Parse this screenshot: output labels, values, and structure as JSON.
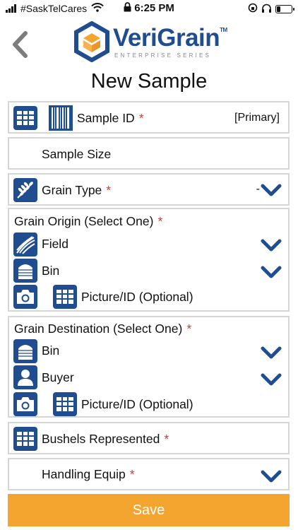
{
  "status_bar": {
    "carrier": "#SaskTelCares",
    "time": "6:25 PM",
    "battery_level": 0.25
  },
  "header": {
    "logo_name": "VeriGrain",
    "logo_tm": "TM",
    "logo_tagline": "ENTERPRISE SERIES",
    "title": "New Sample"
  },
  "colors": {
    "brand_blue": "#1f4d8f",
    "required_red": "#e03131",
    "save_orange": "#f4a52f"
  },
  "form": {
    "sample_id": {
      "label": "Sample ID",
      "required": "*",
      "value": "[Primary]"
    },
    "sample_size": {
      "label": "Sample Size"
    },
    "grain_type": {
      "label": "Grain Type",
      "required": "*",
      "value": "-"
    },
    "grain_origin": {
      "label": "Grain Origin (Select One)",
      "required": "*",
      "field_label": "Field",
      "bin_label": "Bin",
      "picture_label": "Picture/ID (Optional)"
    },
    "grain_destination": {
      "label": "Grain Destination (Select One)",
      "required": "*",
      "bin_label": "Bin",
      "buyer_label": "Buyer",
      "picture_label": "Picture/ID (Optional)"
    },
    "bushels": {
      "label": "Bushels Represented",
      "required": "*"
    },
    "handling_equip": {
      "label": "Handling Equip",
      "required": "*"
    }
  },
  "save_label": "Save",
  "icons": [
    "back-chevron-icon",
    "grid-icon",
    "barcode-icon",
    "wheat-icon",
    "field-icon",
    "silo-bin-icon",
    "camera-icon",
    "person-icon",
    "chevron-down-icon"
  ]
}
